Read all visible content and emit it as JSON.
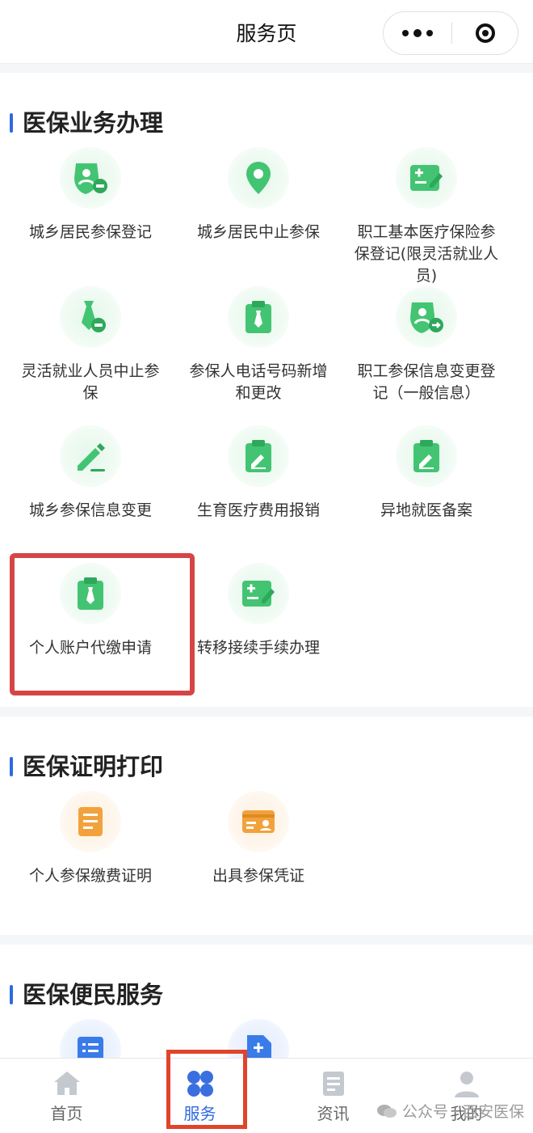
{
  "nav": {
    "title": "服务页"
  },
  "sections": [
    {
      "title": "医保业务办理",
      "items": [
        {
          "label": "城乡居民参保登记",
          "icon": "person-shield-minus-icon"
        },
        {
          "label": "城乡居民中止参保",
          "icon": "location-pin-icon"
        },
        {
          "label": "职工基本医疗保险参保登记(限灵活就业人员)",
          "icon": "form-edit-icon"
        },
        {
          "label": "灵活就业人员中止参保",
          "icon": "tie-minus-icon"
        },
        {
          "label": "参保人电话号码新增和更改",
          "icon": "clipboard-tie-icon"
        },
        {
          "label": "职工参保信息变更登记（一般信息）",
          "icon": "person-shield-arrow-icon"
        },
        {
          "label": "城乡参保信息变更",
          "icon": "pencil-icon"
        },
        {
          "label": "生育医疗费用报销",
          "icon": "clipboard-pen-icon"
        },
        {
          "label": "异地就医备案",
          "icon": "clipboard-pen-icon"
        },
        {
          "label": "个人账户代缴申请",
          "icon": "clipboard-tie-icon"
        },
        {
          "label": "转移接续手续办理",
          "icon": "form-edit-icon"
        }
      ]
    },
    {
      "title": "医保证明打印",
      "items": [
        {
          "label": "个人参保缴费证明",
          "icon": "document-list-icon"
        },
        {
          "label": "出具参保凭证",
          "icon": "id-card-icon"
        }
      ]
    },
    {
      "title": "医保便民服务",
      "items": [
        {
          "label": "",
          "icon": "list-icon"
        },
        {
          "label": "",
          "icon": "document-plus-icon"
        }
      ]
    }
  ],
  "tabs": [
    {
      "label": "首页",
      "icon": "home-icon"
    },
    {
      "label": "服务",
      "icon": "grid-icon",
      "active": true
    },
    {
      "label": "资讯",
      "icon": "news-icon"
    },
    {
      "label": "我的",
      "icon": "user-icon"
    }
  ],
  "watermark": {
    "text": "公众号 · 西安医保"
  },
  "colors": {
    "accent": "#2e6ae0",
    "green": "#3dc46a",
    "orange": "#f2a23c",
    "highlight": "#d64545"
  }
}
